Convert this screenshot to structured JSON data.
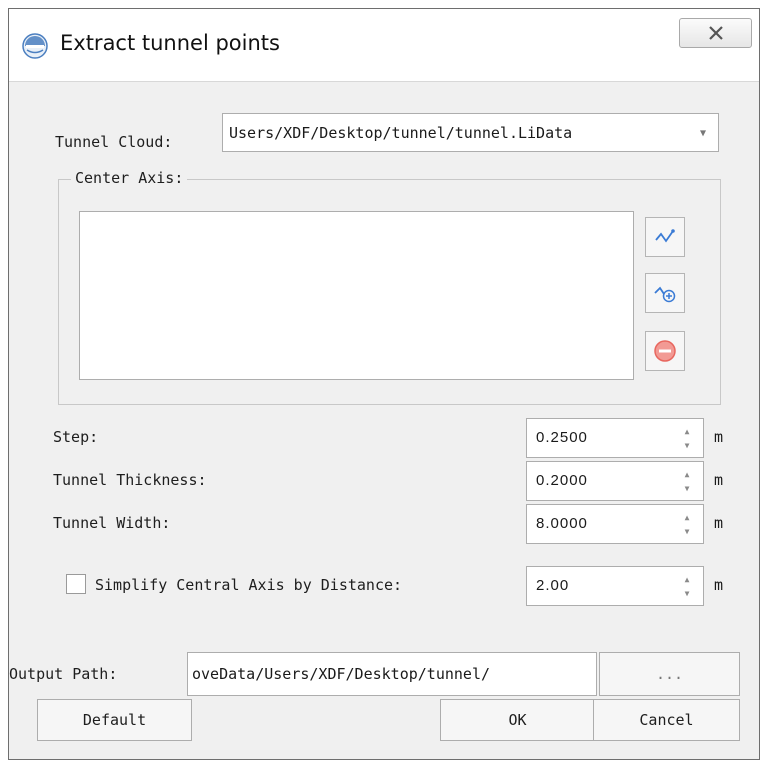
{
  "window": {
    "title": "Extract tunnel points",
    "close_icon": "close-icon"
  },
  "tunnel_cloud": {
    "label": "Tunnel Cloud:",
    "value": "Users/XDF/Desktop/tunnel/tunnel.LiData"
  },
  "center_axis": {
    "label": "Center Axis:",
    "items": [],
    "buttons": [
      {
        "name": "draw-axis-button",
        "icon": "polyline-icon"
      },
      {
        "name": "add-axis-button",
        "icon": "polyline-add-icon"
      },
      {
        "name": "remove-axis-button",
        "icon": "remove-icon"
      }
    ]
  },
  "params": {
    "step": {
      "label": "Step:",
      "value": "0.2500",
      "unit": "m"
    },
    "thickness": {
      "label": "Tunnel Thickness:",
      "value": "0.2000",
      "unit": "m"
    },
    "width": {
      "label": "Tunnel Width:",
      "value": "8.0000",
      "unit": "m"
    },
    "simplify": {
      "label": "Simplify Central Axis by Distance:",
      "value": "2.00",
      "unit": "m",
      "checked": false
    }
  },
  "output": {
    "label": "Output Path:",
    "value": "oveData/Users/XDF/Desktop/tunnel/",
    "browse_label": "..."
  },
  "buttons": {
    "default_label": "Default",
    "ok_label": "OK",
    "cancel_label": "Cancel"
  },
  "colors": {
    "dialog_bg": "#f0f0f0",
    "icon_blue": "#3a7bd5",
    "remove_red": "#e8675f"
  }
}
